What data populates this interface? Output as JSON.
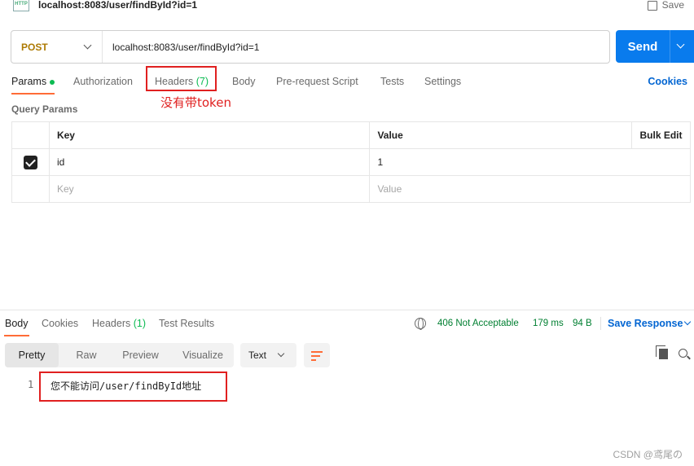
{
  "titlebar": {
    "title": "localhost:8083/user/findById?id=1",
    "http_badge": "HTTP",
    "save_label": "Save"
  },
  "request": {
    "method": "POST",
    "url": "localhost:8083/user/findById?id=1",
    "send_label": "Send"
  },
  "request_tabs": [
    {
      "label": "Params",
      "active": true,
      "dot": true
    },
    {
      "label": "Authorization"
    },
    {
      "label": "Headers",
      "count": "(7)"
    },
    {
      "label": "Body"
    },
    {
      "label": "Pre-request Script"
    },
    {
      "label": "Tests"
    },
    {
      "label": "Settings"
    }
  ],
  "cookies_link": "Cookies",
  "annotation": {
    "note": "没有带token"
  },
  "params": {
    "section_label": "Query Params",
    "headers": {
      "key": "Key",
      "value": "Value",
      "bulk_edit": "Bulk Edit"
    },
    "rows": [
      {
        "checked": true,
        "key": "id",
        "value": "1"
      }
    ],
    "placeholder_row": {
      "key": "Key",
      "value": "Value"
    }
  },
  "response_tabs": [
    {
      "label": "Body",
      "active": true
    },
    {
      "label": "Cookies"
    },
    {
      "label": "Headers",
      "count": "(1)"
    },
    {
      "label": "Test Results"
    }
  ],
  "response_meta": {
    "status": "406 Not Acceptable",
    "time": "179 ms",
    "size": "94 B",
    "save_response": "Save Response"
  },
  "view_modes": [
    "Pretty",
    "Raw",
    "Preview",
    "Visualize"
  ],
  "active_view": "Pretty",
  "format": "Text",
  "body": {
    "line_number": "1",
    "content": "您不能访问/user/findById地址"
  },
  "watermark": "CSDN @鸢尾の",
  "colors": {
    "accent": "#ff6c37",
    "send": "#097bed",
    "success": "#007f31",
    "annotation": "#e02020"
  },
  "icons": [
    "http-icon",
    "save-icon",
    "chevron-down-icon",
    "checkbox-icon",
    "globe-icon",
    "wrap-lines-icon",
    "copy-icon",
    "search-icon"
  ]
}
